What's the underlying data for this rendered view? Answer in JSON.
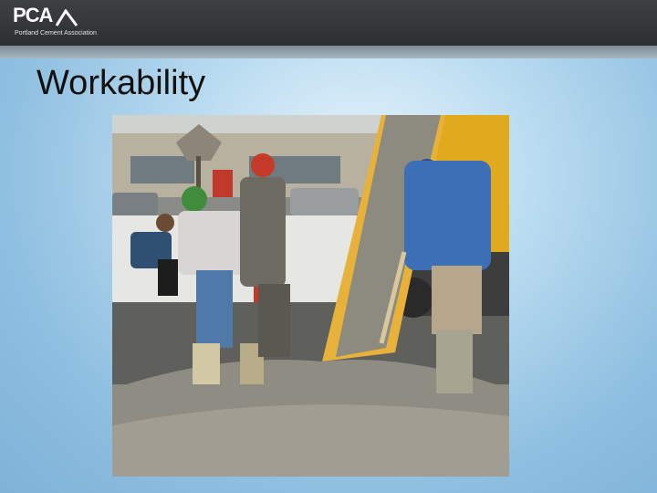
{
  "header": {
    "logo_text": "PCA",
    "logo_subtitle": "Portland Cement Association"
  },
  "slide": {
    "title": "Workability"
  },
  "colors": {
    "top_bar": "#333537",
    "title_text": "#111111",
    "background": "#a9d0ea"
  },
  "icons": [
    "pca-logo-icon"
  ]
}
